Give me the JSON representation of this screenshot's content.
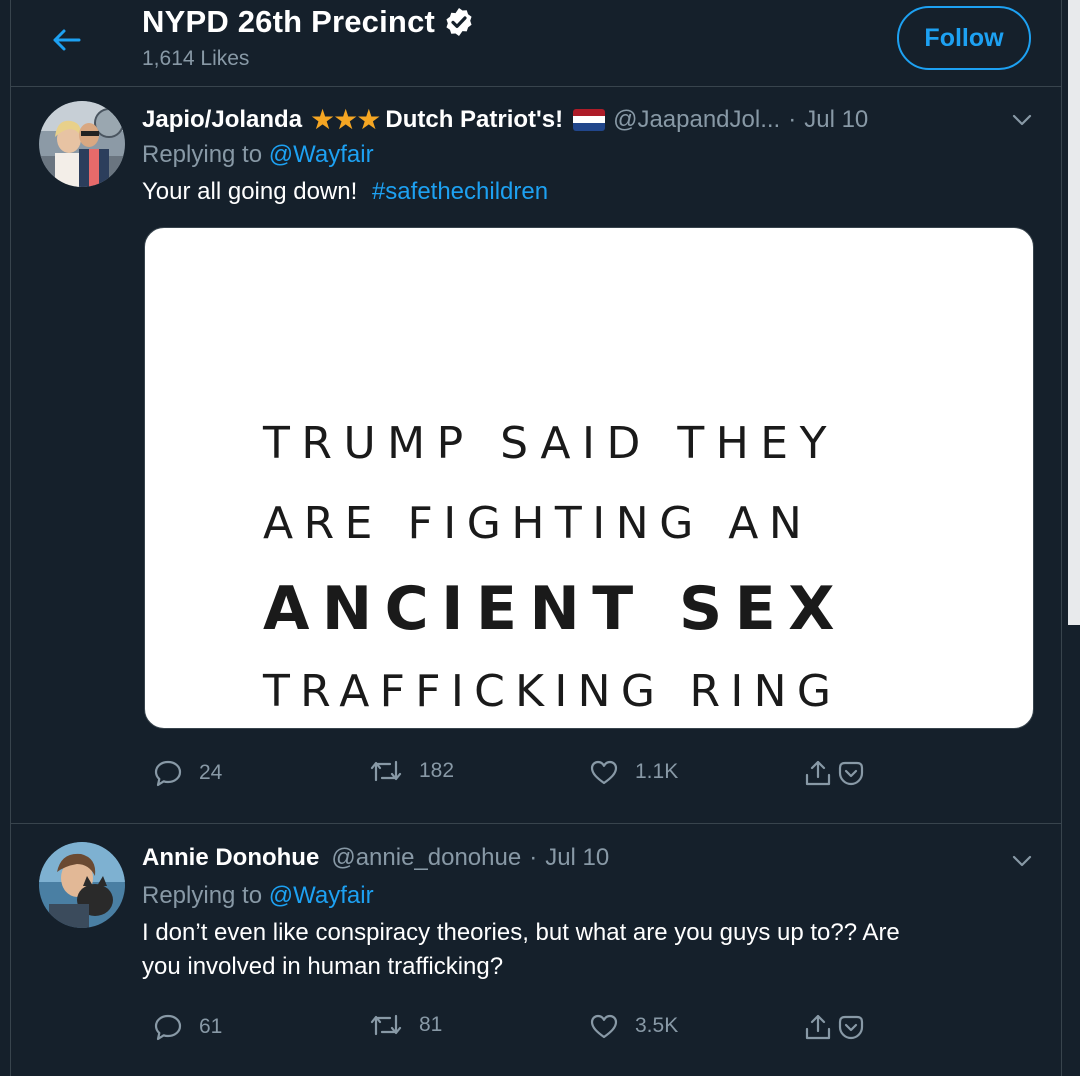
{
  "header": {
    "title": "NYPD 26th Precinct",
    "subtitle": "1,614 Likes",
    "follow_label": "Follow"
  },
  "tweets": [
    {
      "name": "Japio/Jolanda",
      "stars": "★★★",
      "name_suffix": "Dutch Patriot's!",
      "handle": "@JaapandJol...",
      "date": "Jul 10",
      "replying_prefix": "Replying to",
      "replying_to": "@Wayfair",
      "text": "Your all going down!",
      "hashtag": "#safethechildren",
      "media_lines": [
        "TRUMP SAID THEY",
        "ARE FIGHTING AN",
        "ANCIENT SEX",
        "TRAFFICKING RING"
      ],
      "replies": "24",
      "retweets": "182",
      "likes": "1.1K"
    },
    {
      "name": "Annie Donohue",
      "handle": "@annie_donohue",
      "date": "Jul 10",
      "replying_prefix": "Replying to",
      "replying_to": "@Wayfair",
      "text_lines": [
        "I don’t even like conspiracy theories, but what are you guys up to?? Are",
        "you involved in human trafficking?"
      ],
      "replies": "61",
      "retweets": "81",
      "likes": "3.5K"
    }
  ],
  "colors": {
    "background": "#15202b",
    "accent": "#1da1f2",
    "muted": "#8899a6",
    "border": "#38444d",
    "star": "#f5a623"
  },
  "icons": [
    "back-arrow-icon",
    "verified-badge-icon",
    "chevron-down-icon",
    "reply-icon",
    "retweet-icon",
    "like-icon",
    "share-icon",
    "bookmark-icon",
    "netherlands-flag-icon"
  ]
}
